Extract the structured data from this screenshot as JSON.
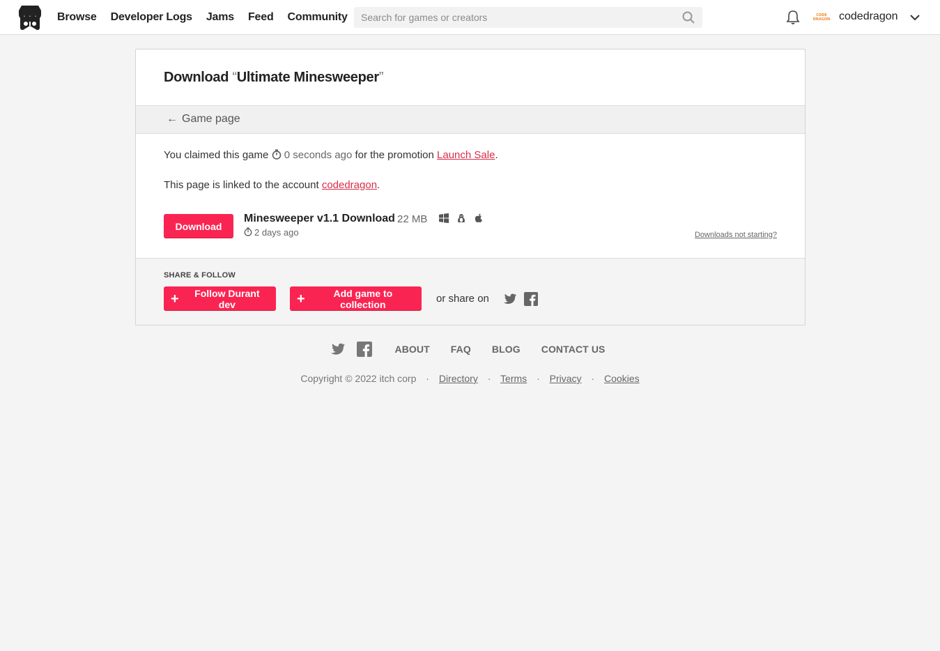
{
  "header": {
    "nav": [
      "Browse",
      "Developer Logs",
      "Jams",
      "Feed",
      "Community"
    ],
    "search_placeholder": "Search for games or creators",
    "username": "codedragon",
    "avatar_text": "CODE DRAGON"
  },
  "panel": {
    "title_prefix": "Download ",
    "open_quote": "“",
    "game_title": "Ultimate Minesweeper",
    "close_quote": "”",
    "back_arrow": "←",
    "back_label": "Game page",
    "claim_pre": "You claimed this game ",
    "claim_time": "0 seconds ago",
    "claim_mid": " for the promotion ",
    "promotion": "Launch Sale",
    "period": ".",
    "linked_pre": "This page is linked to the account ",
    "linked_account": "codedragon",
    "download_button": "Download",
    "file_name": "Minesweeper v1.1 Download",
    "file_size": "22 MB",
    "file_date": "2 days ago",
    "help_link": "Downloads not starting?",
    "share_heading": "SHARE & FOLLOW",
    "follow_button": "Follow Durant dev",
    "collection_button": "Add game to collection",
    "share_on": "or share on"
  },
  "footer": {
    "links": [
      "ABOUT",
      "FAQ",
      "BLOG",
      "CONTACT US"
    ],
    "copyright": "Copyright © 2022 itch corp",
    "bottom_links": [
      "Directory",
      "Terms",
      "Privacy",
      "Cookies"
    ],
    "separator": "·"
  },
  "colors": {
    "accent": "#fa2452",
    "link": "#da2c49"
  }
}
